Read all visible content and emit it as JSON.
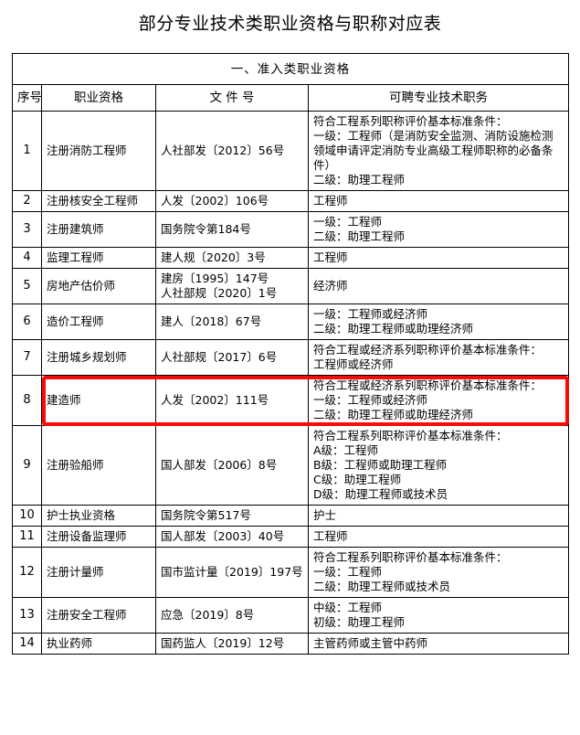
{
  "document": {
    "title": "部分专业技术类职业资格与职称对应表"
  },
  "table": {
    "section_title": "一、准入类职业资格",
    "columns": [
      {
        "key": "no",
        "label": "序号"
      },
      {
        "key": "qual",
        "label": "职业资格"
      },
      {
        "key": "doc",
        "label": "文 件 号"
      },
      {
        "key": "post",
        "label": "可聘专业技术职务"
      }
    ],
    "highlight": {
      "row_index": 8,
      "color": "#fb0b07",
      "spans_columns": [
        "qual",
        "doc",
        "post"
      ]
    },
    "rows": [
      {
        "no": "1",
        "qual": "注册消防工程师",
        "doc": "人社部发〔2012〕56号",
        "post_lines": [
          "符合工程系列职称评价基本标准条件：",
          "一级：工程师（是消防安全监测、消防设施检测领域申请评定消防专业高级工程师职称的必备条件）",
          "二级：助理工程师"
        ]
      },
      {
        "no": "2",
        "qual": "注册核安全工程师",
        "doc": "人发〔2002〕106号",
        "post_lines": [
          "工程师"
        ]
      },
      {
        "no": "3",
        "qual": "注册建筑师",
        "doc": "国务院令第184号",
        "post_lines": [
          "一级：工程师",
          "二级：助理工程师"
        ]
      },
      {
        "no": "4",
        "qual": "监理工程师",
        "doc": "建人规〔2020〕3号",
        "post_lines": [
          "工程师"
        ]
      },
      {
        "no": "5",
        "qual": "房地产估价师",
        "doc_lines": [
          "建房〔1995〕147号",
          "人社部规〔2020〕1号"
        ],
        "post_lines": [
          "经济师"
        ]
      },
      {
        "no": "6",
        "qual": "造价工程师",
        "doc": "建人〔2018〕67号",
        "post_lines": [
          "一级：工程师或经济师",
          "二级：助理工程师或助理经济师"
        ]
      },
      {
        "no": "7",
        "qual": "注册城乡规划师",
        "doc": "人社部规〔2017〕6号",
        "post_lines": [
          "符合工程或经济系列职称评价基本标准条件：",
          "工程师或经济师"
        ]
      },
      {
        "no": "8",
        "qual": "建造师",
        "doc": "人发〔2002〕111号",
        "post_lines": [
          "符合工程或经济系列职称评价基本标准条件：",
          "一级：工程师或经济师",
          "二级：助理工程师或助理经济师"
        ]
      },
      {
        "no": "9",
        "qual": "注册验船师",
        "doc": "国人部发〔2006〕8号",
        "post_lines": [
          "符合工程系列职称评价基本标准条件：",
          "A级：工程师",
          "B级：工程师或助理工程师",
          "C级：助理工程师",
          "D级：助理工程师或技术员"
        ]
      },
      {
        "no": "10",
        "qual": "护士执业资格",
        "doc": "国务院令第517号",
        "post_lines": [
          "护士"
        ]
      },
      {
        "no": "11",
        "qual": "注册设备监理师",
        "doc": "国人部发〔2003〕40号",
        "post_lines": [
          "工程师"
        ]
      },
      {
        "no": "12",
        "qual": "注册计量师",
        "doc": "国市监计量〔2019〕197号",
        "post_lines": [
          "符合工程系列职称评价基本标准条件：",
          "一级：工程师",
          "二级：助理工程师或技术员"
        ]
      },
      {
        "no": "13",
        "qual": "注册安全工程师",
        "doc": "应急〔2019〕8号",
        "post_lines": [
          "中级：工程师",
          "初级：助理工程师"
        ]
      },
      {
        "no": "14",
        "qual": "执业药师",
        "doc": "国药监人〔2019〕12号",
        "post_lines": [
          "主管药师或主管中药师"
        ]
      }
    ]
  }
}
